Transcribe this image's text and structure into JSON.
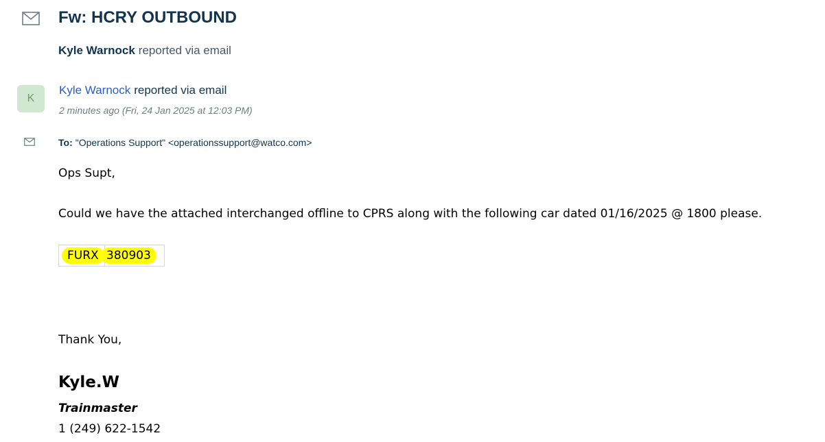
{
  "ticket": {
    "title": "Fw: HCRY OUTBOUND",
    "reporter_name": "Kyle Warnock",
    "reporter_via": "reported via email",
    "icon": "envelope-icon"
  },
  "message": {
    "avatar_initial": "K",
    "sender_name": "Kyle Warnock",
    "sender_via": "reported via email",
    "timestamp": "2 minutes ago (Fri, 24 Jan 2025 at 12:03 PM)",
    "to_label": "To:",
    "to_value": "\"Operations Support\" <operationssupport@watco.com>"
  },
  "body": {
    "greeting": "Ops Supt,",
    "request": "Could we have the attached interchanged offline to CPRS along with the following car dated 01/16/2025 @ 1800 please.",
    "car_table": [
      {
        "mark": "FURX",
        "number": "380903"
      }
    ],
    "closing": "Thank You,"
  },
  "signature": {
    "name": "Kyle.W",
    "title": "Trainmaster",
    "phone": "1 (249) 622-1542"
  },
  "colors": {
    "title_text": "#12344d",
    "link_blue": "#2c5cc5",
    "highlight": "#ffff00",
    "avatar_bg": "#cfe8cf"
  }
}
